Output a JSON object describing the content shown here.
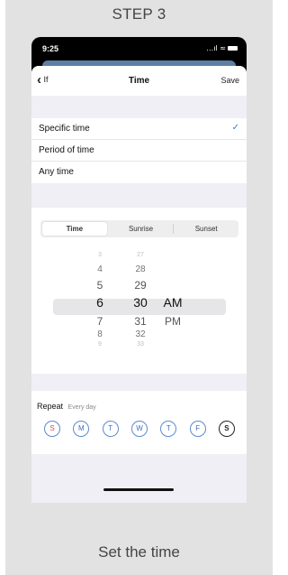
{
  "step_title": "STEP 3",
  "caption": "Set the time",
  "status_bar": {
    "time": "9:25",
    "icons": "…ıl ◠"
  },
  "nav": {
    "back_chevron": "‹",
    "back_label": "If",
    "title": "Time",
    "save_label": "Save"
  },
  "time_options": [
    {
      "label": "Specific time",
      "checked": true
    },
    {
      "label": "Period of time",
      "checked": false
    },
    {
      "label": "Any time",
      "checked": false
    }
  ],
  "check_glyph": "✓",
  "segments": [
    {
      "label": "Time",
      "active": true
    },
    {
      "label": "Sunrise",
      "active": false
    },
    {
      "label": "Sunset",
      "active": false
    }
  ],
  "picker": {
    "hours": [
      "3",
      "4",
      "5",
      "6",
      "7",
      "8",
      "9"
    ],
    "minutes": [
      "27",
      "28",
      "29",
      "30",
      "31",
      "32",
      "33"
    ],
    "period": [
      "AM",
      "PM"
    ],
    "selected_hour": "6",
    "selected_minute": "30",
    "selected_period": "AM"
  },
  "repeat": {
    "label": "Repeat",
    "summary": "Every day",
    "days": [
      {
        "letter": "S",
        "style": "red"
      },
      {
        "letter": "M",
        "style": "normal"
      },
      {
        "letter": "T",
        "style": "normal"
      },
      {
        "letter": "W",
        "style": "normal"
      },
      {
        "letter": "T",
        "style": "normal"
      },
      {
        "letter": "F",
        "style": "normal"
      },
      {
        "letter": "S",
        "style": "selected"
      }
    ]
  },
  "colors": {
    "accent": "#3a7bd5",
    "sunday": "#d05050",
    "header_blue": "#5c7fa6"
  }
}
